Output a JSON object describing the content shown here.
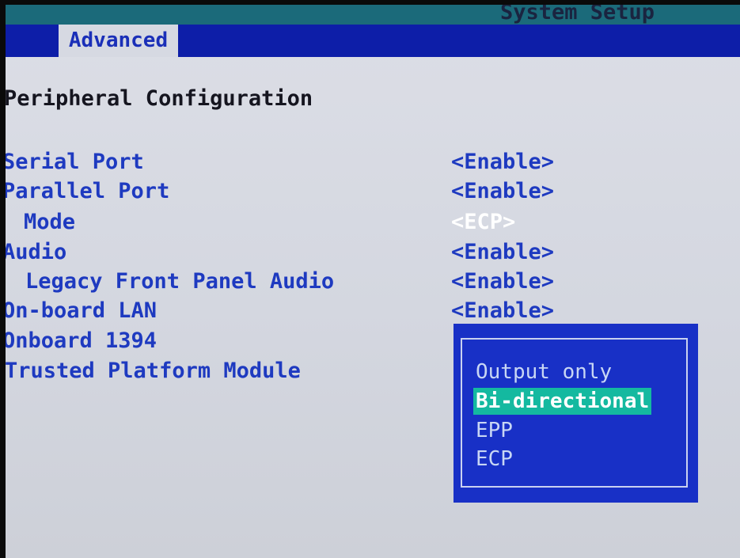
{
  "header": {
    "title": "System Setup",
    "active_tab": "Advanced"
  },
  "section": {
    "title": "Peripheral Configuration"
  },
  "options": [
    {
      "label": "Serial Port",
      "value": "<Enable>"
    },
    {
      "label": "Parallel Port",
      "value": "<Enable>"
    },
    {
      "label": "Mode",
      "value": "<ECP>"
    },
    {
      "label": "Audio",
      "value": "<Enable>"
    },
    {
      "label": "Legacy Front Panel Audio",
      "value": "<Enable>"
    },
    {
      "label": "On-board LAN",
      "value": "<Enable>"
    },
    {
      "label": "Onboard 1394",
      "value": ""
    },
    {
      "label": "Trusted Platform Module",
      "value": ""
    }
  ],
  "popup": {
    "options": [
      "Output only",
      "Bi-directional",
      "EPP",
      "ECP"
    ],
    "selected": "Bi-directional"
  },
  "colors": {
    "menu_bar": "#0d1ea8",
    "background": "#dcdee6",
    "option_text": "#1e3ac0",
    "popup_background": "#1830c6",
    "popup_highlight": "#14b9a0"
  }
}
